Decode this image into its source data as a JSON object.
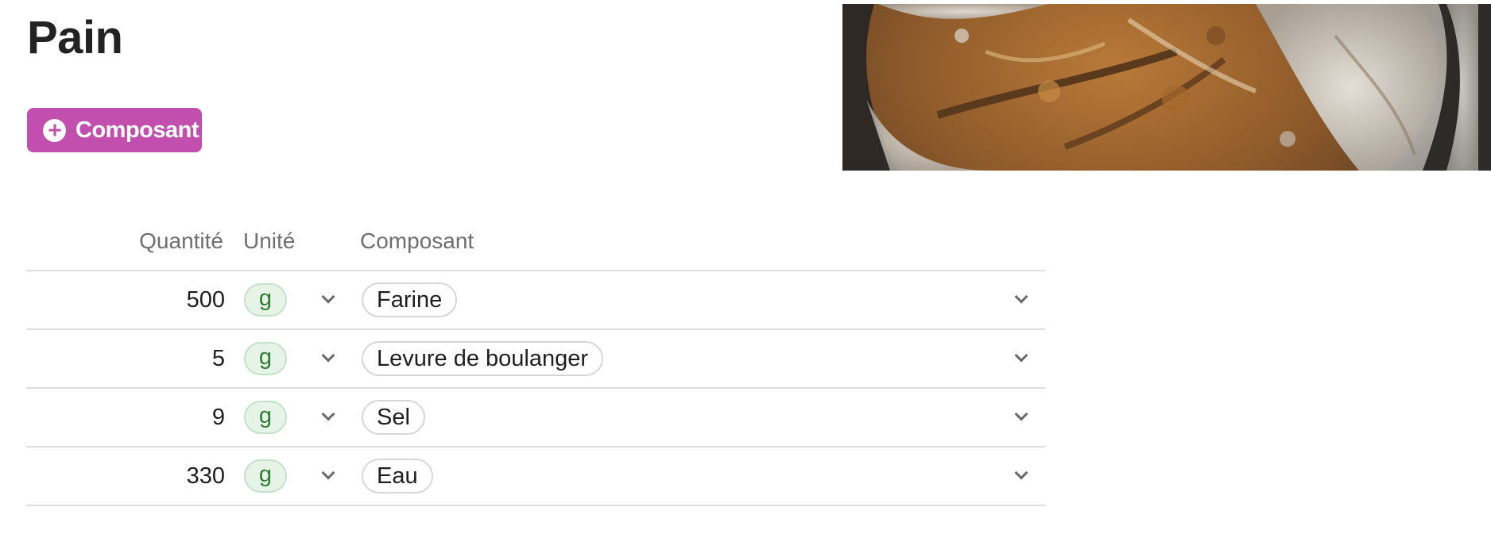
{
  "page": {
    "title": "Pain"
  },
  "actions": {
    "add_component_label": "Composant",
    "add_component_icon": "plus-circle-icon",
    "accent_color": "#c24fae"
  },
  "table": {
    "headers": {
      "quantity": "Quantité",
      "unit": "Unité",
      "component": "Composant"
    },
    "rows": [
      {
        "quantity": "500",
        "unit": "g",
        "component": "Farine"
      },
      {
        "quantity": "5",
        "unit": "g",
        "component": "Levure de boulanger"
      },
      {
        "quantity": "9",
        "unit": "g",
        "component": "Sel"
      },
      {
        "quantity": "330",
        "unit": "g",
        "component": "Eau"
      }
    ],
    "unit_pill_color": "#e6f4e7",
    "unit_text_color": "#2e7d32"
  }
}
